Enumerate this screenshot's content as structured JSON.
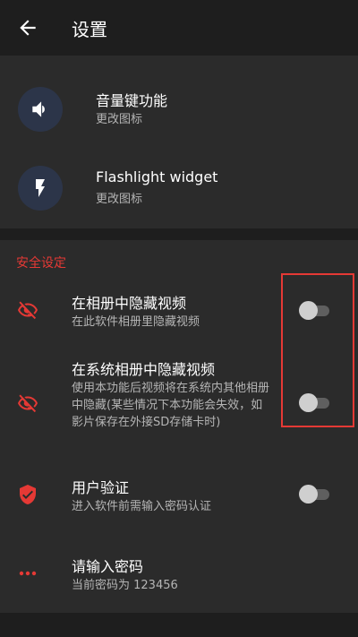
{
  "appbar": {
    "title": "设置",
    "back_icon": "arrow-left-icon"
  },
  "general": [
    {
      "title": "音量键功能",
      "subtitle": "更改图标",
      "icon": "speaker-icon"
    },
    {
      "title": "Flashlight widget",
      "subtitle": "更改图标",
      "icon": "lightning-icon"
    }
  ],
  "security": {
    "header": "安全设定",
    "items": [
      {
        "title": "在相册中隐藏视频",
        "subtitle": "在此软件相册里隐藏视频",
        "icon": "eye-off-icon",
        "toggle": false
      },
      {
        "title": "在系统相册中隐藏视频",
        "subtitle": "使用本功能后视频将在系统内其他相册中隐藏(某些情况下本功能会失效，如影片保存在外接SD存储卡时)",
        "icon": "eye-off-icon",
        "toggle": false
      },
      {
        "title": "用户验证",
        "subtitle": "进入软件前需输入密码认证",
        "icon": "shield-check-icon",
        "toggle": false
      },
      {
        "title": "请输入密码",
        "subtitle": "当前密码为 123456",
        "icon": "more-dots-icon"
      }
    ]
  },
  "colors": {
    "accent": "#e53935",
    "background": "#1e1e1e",
    "card": "#2b2b2b",
    "icon_circle": "#2c3549"
  }
}
